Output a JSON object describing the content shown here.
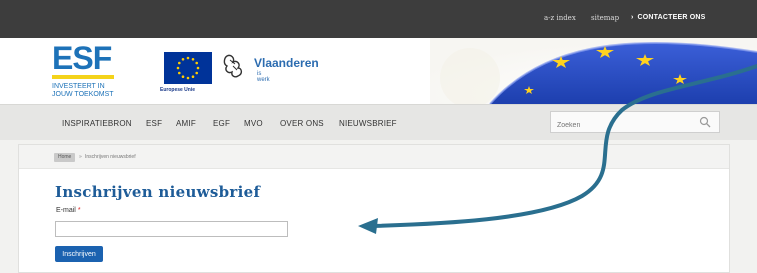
{
  "topbar": {
    "az_index": "a-z index",
    "sitemap": "sitemap",
    "contact": "CONTACTEER ONS"
  },
  "header": {
    "logo_word": "ESF",
    "logo_tagline_line1": "INVESTEERT IN",
    "logo_tagline_line2": "JOUW TOEKOMST",
    "eu_label": "Europese Unie",
    "vlaanderen_name": "Vlaanderen",
    "vlaanderen_sub": "is werk"
  },
  "nav": {
    "items": [
      "INSPIRATIEBRON",
      "ESF",
      "AMIF",
      "EGF",
      "MVO",
      "OVER ONS",
      "NIEUWSBRIEF"
    ],
    "search_placeholder": "Zoeken"
  },
  "breadcrumb": {
    "home": "Home",
    "separator": "»",
    "current": "Inschrijven nieuwsbrief"
  },
  "main": {
    "title": "Inschrijven nieuwsbrief",
    "email_label": "E-mail",
    "required_mark": "*",
    "email_value": "",
    "submit_label": "Inschrijven"
  },
  "colors": {
    "topbar_bg": "#3d3d3d",
    "brand_blue": "#1d72b8",
    "brand_yellow": "#f4d31a",
    "title_blue": "#1e5c98",
    "button_blue": "#1b62b0",
    "annotation_arrow": "#2a6f8f"
  },
  "icons": {
    "contact_chevron": "chevron-right-icon",
    "search": "search-icon",
    "eu_flag": "eu-flag-icon",
    "vlaanderen_lion": "vlaanderen-lion-icon"
  }
}
